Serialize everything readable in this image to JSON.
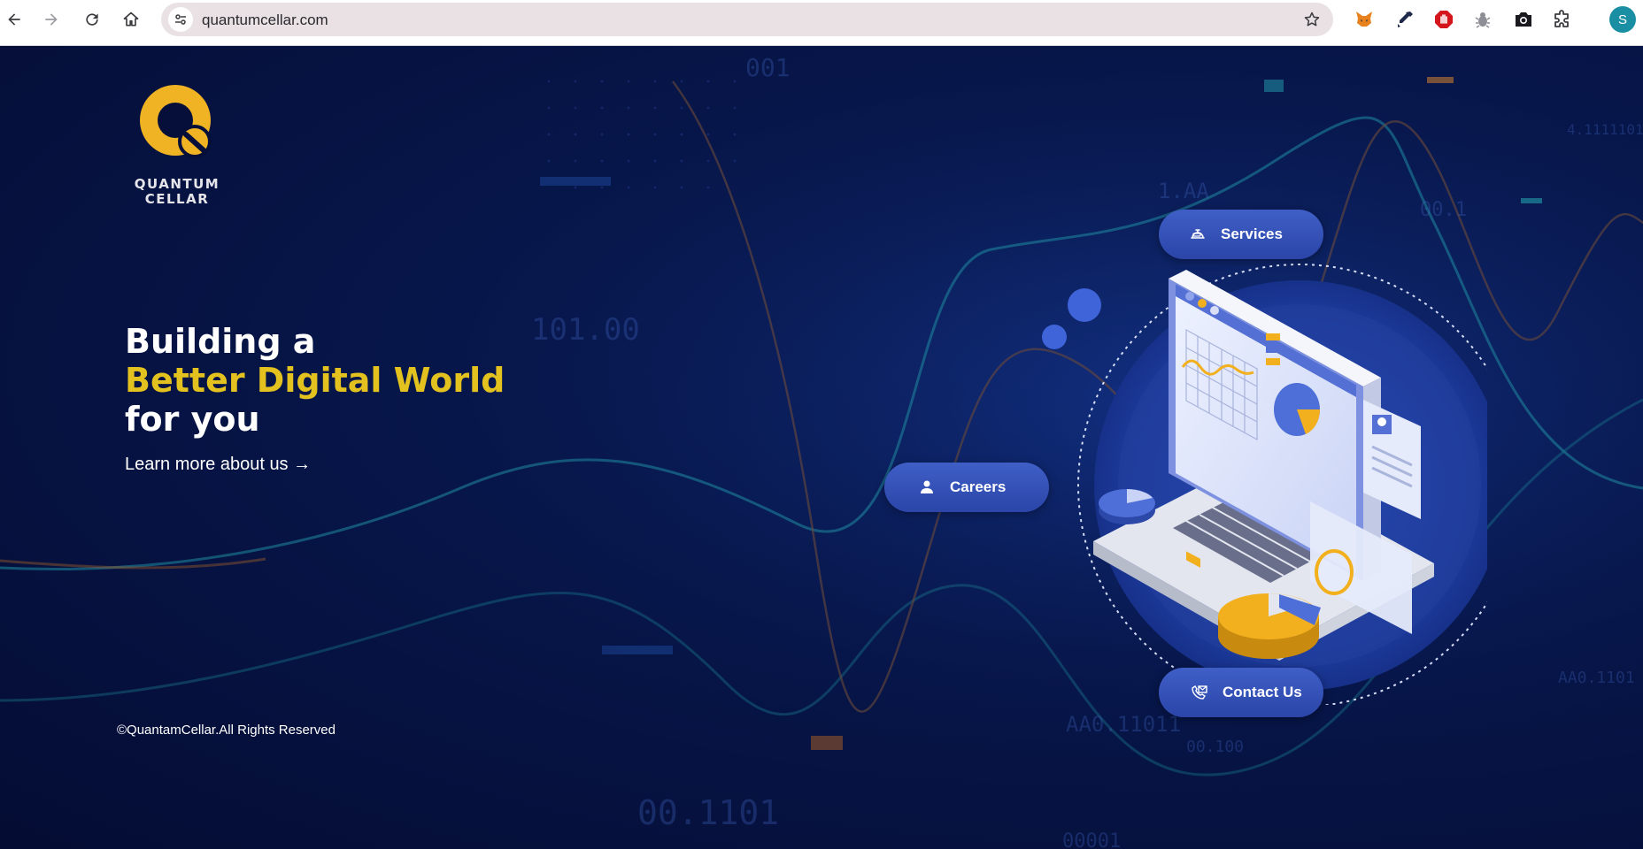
{
  "browser": {
    "url": "quantumcellar.com",
    "profile_initial": "S",
    "icons": [
      "back-icon",
      "forward-icon",
      "reload-icon",
      "home-icon",
      "site-settings-icon",
      "bookmark-star-icon",
      "metamask-fox-icon",
      "eyedropper-icon",
      "adblock-hand-icon",
      "bug-icon",
      "camera-icon",
      "extensions-puzzle-icon"
    ]
  },
  "brand": {
    "line1": "QUANTUM",
    "line2": "CELLAR",
    "accent_color": "#e3c21f",
    "logo_color": "#f0b323"
  },
  "hero": {
    "line1": "Building a",
    "line2": "Better Digital World",
    "line3": "for you",
    "link": "Learn more about us →"
  },
  "nav": {
    "services": "Services",
    "careers": "Careers",
    "contact": "Contact Us"
  },
  "footer": {
    "copyright": "©QuantamCellar.All Rights Reserved"
  },
  "background": {
    "labels": [
      "001",
      "1.AA",
      "00.1",
      "4.1111101",
      "101.00",
      "AA0.11011",
      "AA0.1101",
      "00.1101",
      "00.100",
      "00001"
    ]
  }
}
